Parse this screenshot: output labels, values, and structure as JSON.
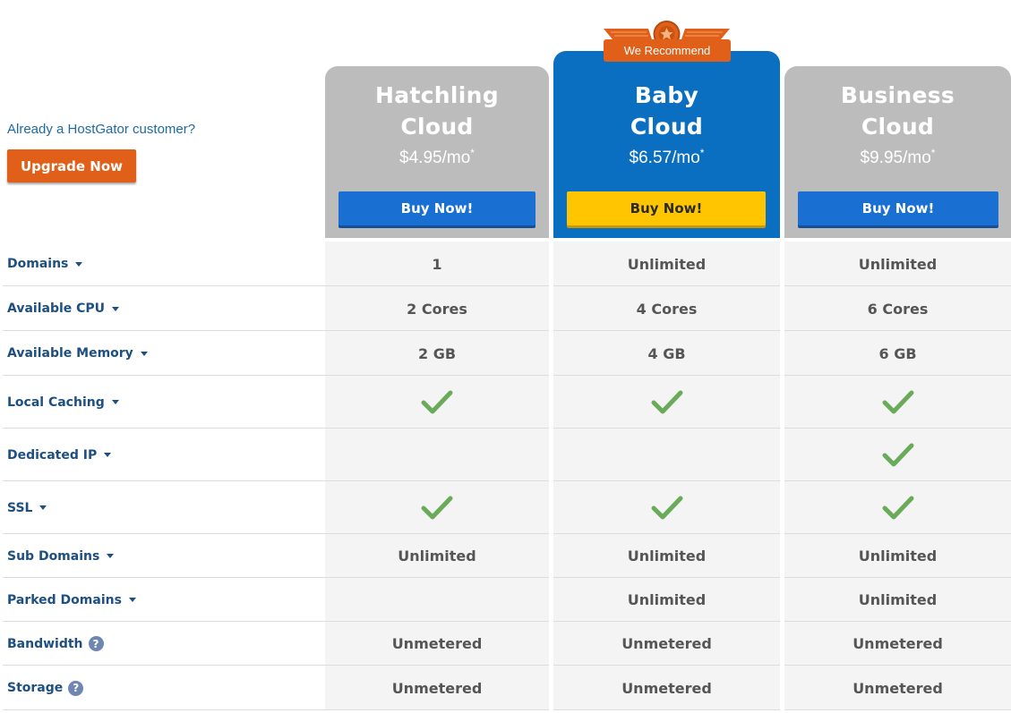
{
  "sidebar": {
    "customer_text": "Already a HostGator customer?",
    "upgrade_label": "Upgrade Now"
  },
  "badge": {
    "label": "We Recommend"
  },
  "plans": [
    {
      "name_line1": "Hatchling",
      "name_line2": "Cloud",
      "price": "$4.95/mo",
      "price_mark": "*",
      "buy_label": "Buy Now!"
    },
    {
      "name_line1": "Baby",
      "name_line2": "Cloud",
      "price": "$6.57/mo",
      "price_mark": "*",
      "buy_label": "Buy Now!"
    },
    {
      "name_line1": "Business",
      "name_line2": "Cloud",
      "price": "$9.95/mo",
      "price_mark": "*",
      "buy_label": "Buy Now!"
    }
  ],
  "features": [
    {
      "label": "Domains",
      "icon": "caret",
      "values": [
        "1",
        "Unlimited",
        "Unlimited"
      ]
    },
    {
      "label": "Available CPU",
      "icon": "caret",
      "values": [
        "2 Cores",
        "4 Cores",
        "6 Cores"
      ]
    },
    {
      "label": "Available Memory",
      "icon": "caret",
      "values": [
        "2 GB",
        "4 GB",
        "6 GB"
      ]
    },
    {
      "label": "Local Caching",
      "icon": "caret",
      "values": [
        "check",
        "check",
        "check"
      ]
    },
    {
      "label": "Dedicated IP",
      "icon": "caret",
      "values": [
        "",
        "",
        "check"
      ]
    },
    {
      "label": "SSL",
      "icon": "caret",
      "values": [
        "check",
        "check",
        "check"
      ]
    },
    {
      "label": "Sub Domains",
      "icon": "caret",
      "values": [
        "Unlimited",
        "Unlimited",
        "Unlimited"
      ]
    },
    {
      "label": "Parked Domains",
      "icon": "caret",
      "values": [
        "",
        "Unlimited",
        "Unlimited"
      ]
    },
    {
      "label": "Bandwidth",
      "icon": "help",
      "values": [
        "Unmetered",
        "Unmetered",
        "Unmetered"
      ]
    },
    {
      "label": "Storage",
      "icon": "help",
      "values": [
        "Unmetered",
        "Unmetered",
        "Unmetered"
      ]
    }
  ],
  "help_glyph": "?",
  "colors": {
    "accent_orange": "#e0601a",
    "baby_blue": "#0a6fc0",
    "buy_blue": "#1a6fd3",
    "buy_yellow": "#ffc600",
    "check_green": "#6aab5a",
    "label_blue": "#1d4f82"
  }
}
